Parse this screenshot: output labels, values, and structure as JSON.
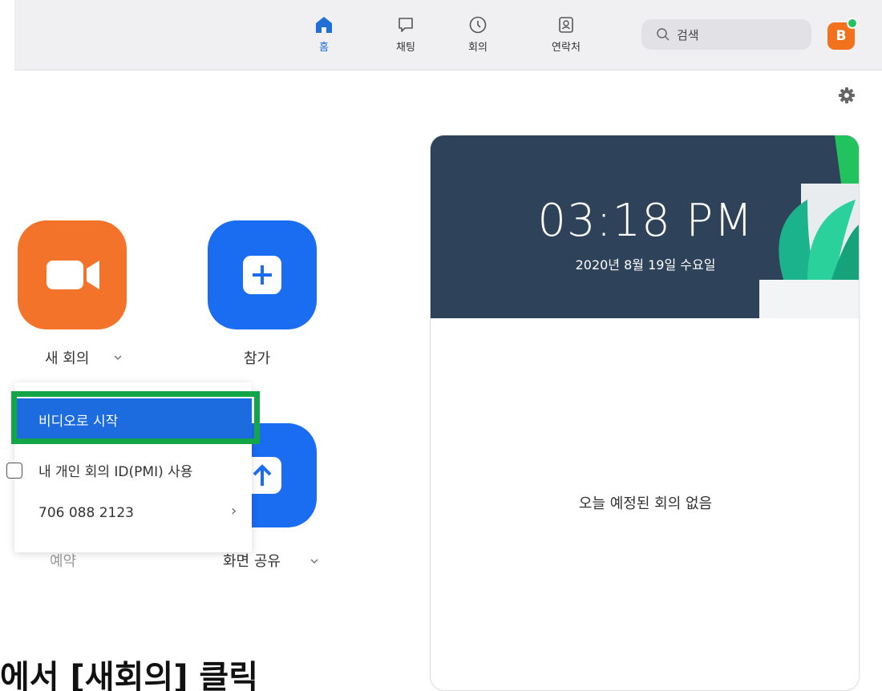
{
  "nav": {
    "home": "홈",
    "chat": "채팅",
    "meetings": "회의",
    "contacts": "연락처"
  },
  "search": {
    "placeholder": "검색"
  },
  "avatar": {
    "initial": "B"
  },
  "actions": {
    "new_meeting": "새 회의",
    "join": "참가",
    "schedule": "예약",
    "share_screen": "화면 공유"
  },
  "new_meeting_menu": {
    "start_with_video": "비디오로 시작",
    "use_pmi": "내 개인 회의 ID(PMI) 사용",
    "pmi_number": "706 088 2123"
  },
  "card": {
    "time": "03:18 PM",
    "date": "2020년 8월 19일 수요일",
    "empty_text": "오늘 예정된 회의 없음"
  },
  "caption": "에서 [새회의] 클릭",
  "colors": {
    "accent": "#1a6cf0",
    "new_meeting": "#f4732a",
    "highlight": "#13a548"
  }
}
